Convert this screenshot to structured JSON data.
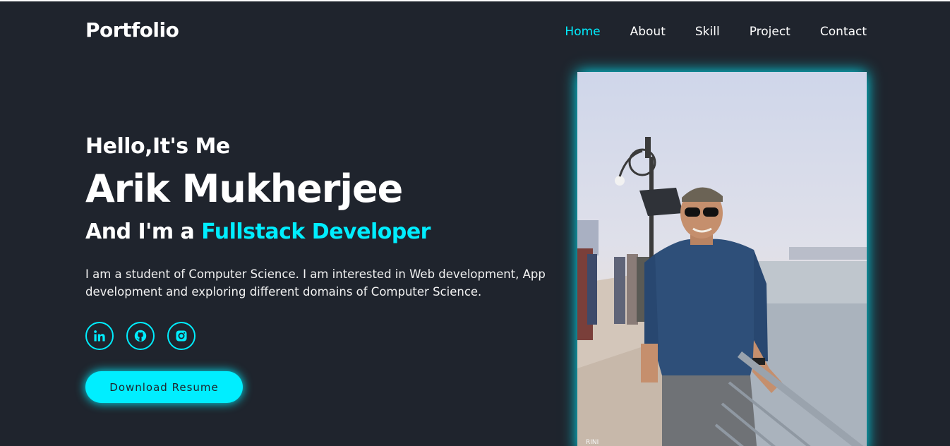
{
  "header": {
    "logo": "Portfolio",
    "nav": [
      {
        "label": "Home",
        "active": true
      },
      {
        "label": "About",
        "active": false
      },
      {
        "label": "Skill",
        "active": false
      },
      {
        "label": "Project",
        "active": false
      },
      {
        "label": "Contact",
        "active": false
      }
    ]
  },
  "hero": {
    "greeting": "Hello,It's Me",
    "name": "Arik Mukherjee",
    "role_prefix": "And I'm a",
    "role_highlight": "Fullstack Developer",
    "description": "I am a student of Computer Science. I am interested in Web development, App development and exploring different domains of Computer Science.",
    "social": [
      {
        "icon": "linkedin-icon"
      },
      {
        "icon": "github-icon"
      },
      {
        "icon": "instagram-icon"
      }
    ],
    "button_label": "Download Resume"
  },
  "photo": {
    "watermark": "RINI"
  },
  "colors": {
    "background": "#1f242d",
    "accent": "#00eeff",
    "text": "#ffffff"
  }
}
